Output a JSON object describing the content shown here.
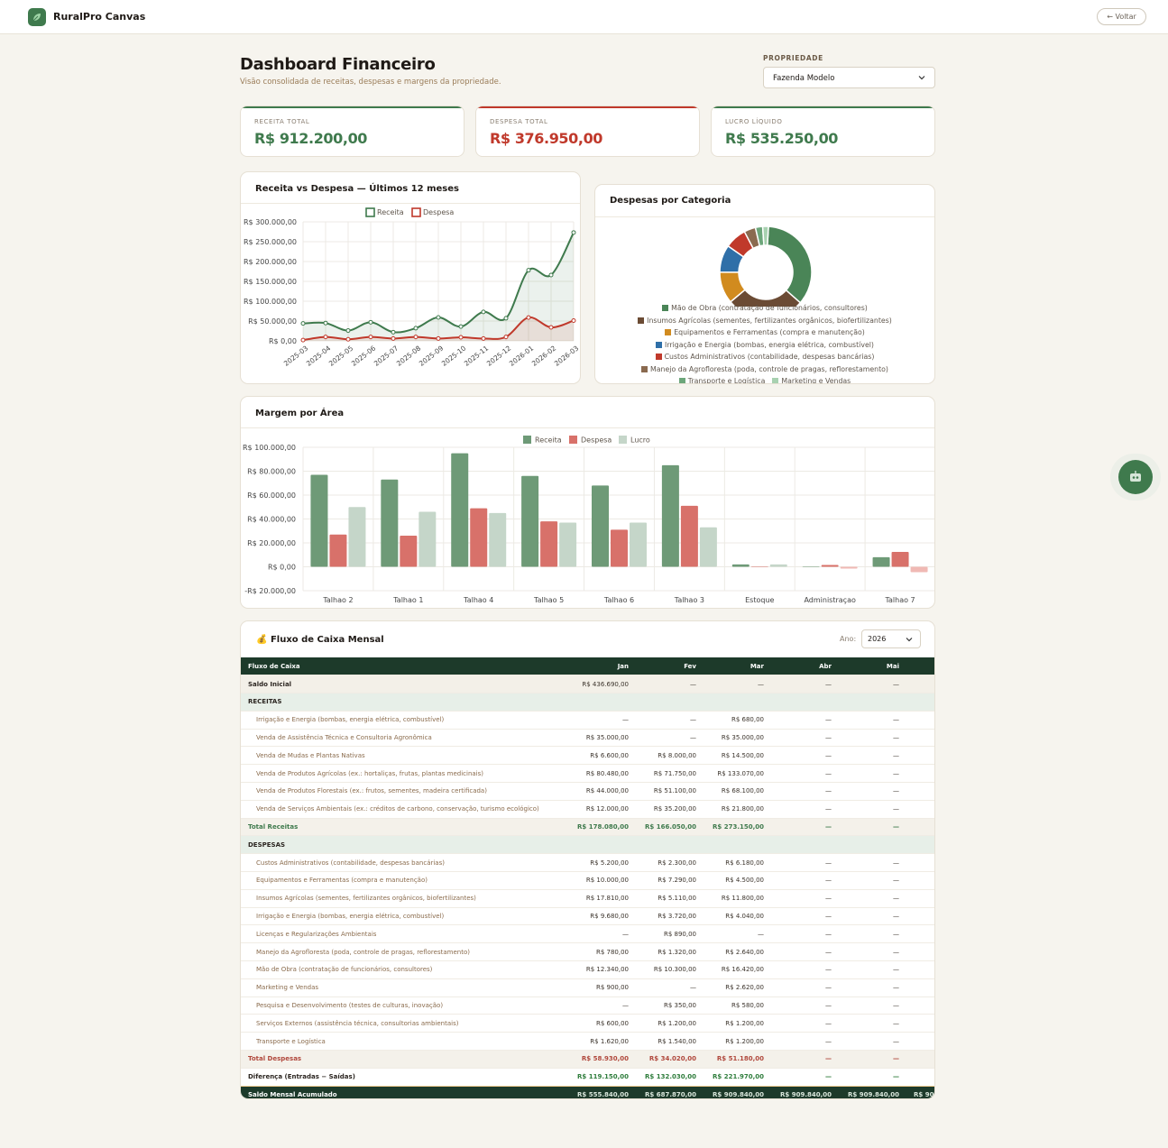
{
  "app": {
    "name": "RuralPro Canvas",
    "back_label": "← Voltar"
  },
  "header": {
    "title": "Dashboard Financeiro",
    "subtitle": "Visão consolidada de receitas, despesas e margens da propriedade.",
    "property_label": "PROPRIEDADE",
    "property_value": "Fazenda Modelo"
  },
  "kpis": [
    {
      "label": "RECEITA TOTAL",
      "value": "R$ 912.200,00",
      "color": "#3f7a4d"
    },
    {
      "label": "DESPESA TOTAL",
      "value": "R$ 376.950,00",
      "color": "#c0392b"
    },
    {
      "label": "LUCRO LÍQUIDO",
      "value": "R$ 535.250,00",
      "color": "#3f7a4d"
    }
  ],
  "colors": {
    "receita": "#3f7a4d",
    "despesa": "#c0392b",
    "bar_receita": "#6e9a77",
    "bar_despesa": "#d8716a",
    "bar_lucro": "#c5d6c9",
    "dark": "#1d3a2a"
  },
  "chart_data": [
    {
      "type": "line",
      "title": "Receita vs Despesa — Últimos 12 meses",
      "categories": [
        "2025-03",
        "2025-04",
        "2025-05",
        "2025-06",
        "2025-07",
        "2025-08",
        "2025-09",
        "2025-10",
        "2025-11",
        "2025-12",
        "2026-01",
        "2026-02",
        "2026-03"
      ],
      "series": [
        {
          "name": "Receita",
          "values": [
            44000,
            45000,
            26000,
            47000,
            22000,
            32000,
            59000,
            36000,
            73000,
            57000,
            178000,
            166050,
            273150
          ]
        },
        {
          "name": "Despesa",
          "values": [
            2000,
            10000,
            4000,
            10000,
            6000,
            10000,
            6000,
            9000,
            6000,
            10000,
            58930,
            34020,
            51180
          ]
        }
      ],
      "yticks": [
        "R$ 300.000,00",
        "R$ 250.000,00",
        "R$ 200.000,00",
        "R$ 150.000,00",
        "R$ 100.000,00",
        "R$ 50.000,00",
        "R$ 0,00"
      ],
      "ylim": [
        0,
        300000
      ]
    },
    {
      "type": "pie",
      "title": "Despesas por Categoria",
      "categories": [
        "Mão de Obra (contratação de funcionários, consultores)",
        "Insumos Agrícolas (sementes, fertilizantes orgânicos, biofertilizantes)",
        "Equipamentos e Ferramentas (compra e manutenção)",
        "Irrigação e Energia (bombas, energia elétrica, combustível)",
        "Custos Administrativos (contabilidade, despesas bancárias)",
        "Manejo da Agrofloresta (poda, controle de pragas, reflorestamento)",
        "Transporte e Logística",
        "Marketing e Vendas"
      ],
      "values": [
        35,
        27,
        11,
        9.5,
        7.5,
        4,
        2.5,
        2
      ],
      "colors": [
        "#4a8557",
        "#6b4b34",
        "#d18b1f",
        "#2f6fa8",
        "#c0392b",
        "#8a6a4f",
        "#6ca67a",
        "#a8d1b0"
      ]
    },
    {
      "type": "bar",
      "title": "Margem por Área",
      "categories": [
        "Talhao 2",
        "Talhao 1",
        "Talhao 4",
        "Talhao 5",
        "Talhao 6",
        "Talhao 3",
        "Estoque",
        "Administraçao",
        "Talhao 7"
      ],
      "series": [
        {
          "name": "Receita",
          "values": [
            77000,
            73000,
            95000,
            76000,
            68000,
            85000,
            2000,
            0,
            8000
          ]
        },
        {
          "name": "Despesa",
          "values": [
            27000,
            26000,
            49000,
            38000,
            31000,
            51000,
            0,
            1500,
            12500
          ]
        },
        {
          "name": "Lucro",
          "values": [
            50000,
            46000,
            45000,
            37000,
            37000,
            33000,
            2000,
            -1500,
            -4500
          ]
        }
      ],
      "yticks": [
        "R$ 100.000,00",
        "R$ 80.000,00",
        "R$ 60.000,00",
        "R$ 40.000,00",
        "R$ 20.000,00",
        "R$ 0,00",
        "-R$ 20.000,00"
      ],
      "ylim": [
        -20000,
        100000
      ]
    }
  ],
  "cashflow": {
    "title": "Fluxo de Caixa Mensal",
    "title_icon": "💰",
    "year_label": "Ano:",
    "year_value": "2026",
    "columns": [
      "Fluxo de Caixa",
      "Jan",
      "Fev",
      "Mar",
      "Abr",
      "Mai"
    ],
    "rows": [
      {
        "type": "saldo",
        "cells": [
          "Saldo Inicial",
          "R$ 436.690,00",
          "—",
          "—",
          "—",
          "—"
        ]
      },
      {
        "type": "section",
        "cells": [
          "RECEITAS",
          "",
          "",
          "",
          "",
          ""
        ]
      },
      {
        "type": "item",
        "cells": [
          "Irrigação e Energia (bombas, energia elétrica, combustível)",
          "—",
          "—",
          "R$ 680,00",
          "—",
          "—"
        ]
      },
      {
        "type": "item",
        "cells": [
          "Venda de Assistência Técnica e Consultoria Agronômica",
          "R$ 35.000,00",
          "—",
          "R$ 35.000,00",
          "—",
          "—"
        ]
      },
      {
        "type": "item",
        "cells": [
          "Venda de Mudas e Plantas Nativas",
          "R$ 6.600,00",
          "R$ 8.000,00",
          "R$ 14.500,00",
          "—",
          "—"
        ]
      },
      {
        "type": "item",
        "cells": [
          "Venda de Produtos Agrícolas (ex.: hortaliças, frutas, plantas medicinais)",
          "R$ 80.480,00",
          "R$ 71.750,00",
          "R$ 133.070,00",
          "—",
          "—"
        ]
      },
      {
        "type": "item",
        "cells": [
          "Venda de Produtos Florestais (ex.: frutos, sementes, madeira certificada)",
          "R$ 44.000,00",
          "R$ 51.100,00",
          "R$ 68.100,00",
          "—",
          "—"
        ]
      },
      {
        "type": "item",
        "cells": [
          "Venda de Serviços Ambientais (ex.: créditos de carbono, conservação, turismo ecológico)",
          "R$ 12.000,00",
          "R$ 35.200,00",
          "R$ 21.800,00",
          "—",
          "—"
        ]
      },
      {
        "type": "totr",
        "cells": [
          "Total Receitas",
          "R$ 178.080,00",
          "R$ 166.050,00",
          "R$ 273.150,00",
          "—",
          "—"
        ]
      },
      {
        "type": "section",
        "cells": [
          "DESPESAS",
          "",
          "",
          "",
          "",
          ""
        ]
      },
      {
        "type": "item",
        "cells": [
          "Custos Administrativos (contabilidade, despesas bancárias)",
          "R$ 5.200,00",
          "R$ 2.300,00",
          "R$ 6.180,00",
          "—",
          "—"
        ]
      },
      {
        "type": "item",
        "cells": [
          "Equipamentos e Ferramentas (compra e manutenção)",
          "R$ 10.000,00",
          "R$ 7.290,00",
          "R$ 4.500,00",
          "—",
          "—"
        ]
      },
      {
        "type": "item",
        "cells": [
          "Insumos Agrícolas (sementes, fertilizantes orgânicos, biofertilizantes)",
          "R$ 17.810,00",
          "R$ 5.110,00",
          "R$ 11.800,00",
          "—",
          "—"
        ]
      },
      {
        "type": "item",
        "cells": [
          "Irrigação e Energia (bombas, energia elétrica, combustível)",
          "R$ 9.680,00",
          "R$ 3.720,00",
          "R$ 4.040,00",
          "—",
          "—"
        ]
      },
      {
        "type": "item",
        "cells": [
          "Licenças e Regularizações Ambientais",
          "—",
          "R$ 890,00",
          "—",
          "—",
          "—"
        ]
      },
      {
        "type": "item",
        "cells": [
          "Manejo da Agrofloresta (poda, controle de pragas, reflorestamento)",
          "R$ 780,00",
          "R$ 1.320,00",
          "R$ 2.640,00",
          "—",
          "—"
        ]
      },
      {
        "type": "item",
        "cells": [
          "Mão de Obra (contratação de funcionários, consultores)",
          "R$ 12.340,00",
          "R$ 10.300,00",
          "R$ 16.420,00",
          "—",
          "—"
        ]
      },
      {
        "type": "item",
        "cells": [
          "Marketing e Vendas",
          "R$ 900,00",
          "—",
          "R$ 2.620,00",
          "—",
          "—"
        ]
      },
      {
        "type": "item",
        "cells": [
          "Pesquisa e Desenvolvimento (testes de culturas, inovação)",
          "—",
          "R$ 350,00",
          "R$ 580,00",
          "—",
          "—"
        ]
      },
      {
        "type": "item",
        "cells": [
          "Serviços Externos (assistência técnica, consultorias ambientais)",
          "R$ 600,00",
          "R$ 1.200,00",
          "R$ 1.200,00",
          "—",
          "—"
        ]
      },
      {
        "type": "item",
        "cells": [
          "Transporte e Logística",
          "R$ 1.620,00",
          "R$ 1.540,00",
          "R$ 1.200,00",
          "—",
          "—"
        ]
      },
      {
        "type": "totd",
        "cells": [
          "Total Despesas",
          "R$ 58.930,00",
          "R$ 34.020,00",
          "R$ 51.180,00",
          "—",
          "—"
        ]
      },
      {
        "type": "diff",
        "cells": [
          "Diferença (Entradas − Saídas)",
          "R$ 119.150,00",
          "R$ 132.030,00",
          "R$ 221.970,00",
          "—",
          "—"
        ]
      },
      {
        "type": "acum",
        "cells": [
          "Saldo Mensal Acumulado",
          "R$ 555.840,00",
          "R$ 687.870,00",
          "R$ 909.840,00",
          "R$ 909.840,00",
          "R$ 909.840,00"
        ]
      }
    ]
  },
  "assistant": {
    "icon": "robot-icon"
  }
}
